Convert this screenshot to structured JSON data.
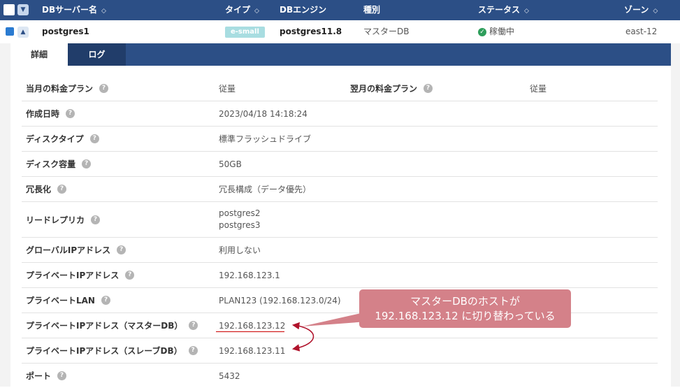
{
  "header": {
    "db_server_name": "DBサーバー名",
    "type": "タイプ",
    "db_engine": "DBエンジン",
    "kind": "種別",
    "status": "ステータス",
    "zone": "ゾーン"
  },
  "row": {
    "name": "postgres1",
    "type_badge": "e-small",
    "engine": "postgres11.8",
    "kind": "マスターDB",
    "status": "稼働中",
    "zone": "east-12"
  },
  "tabs": {
    "detail": "詳細",
    "log": "ログ"
  },
  "details": {
    "plan_current_label": "当月の料金プラン",
    "plan_current_value": "従量",
    "plan_next_label": "翌月の料金プラン",
    "plan_next_value": "従量",
    "created_label": "作成日時",
    "created_value": "2023/04/18 14:18:24",
    "disk_type_label": "ディスクタイプ",
    "disk_type_value": "標準フラッシュドライブ",
    "disk_size_label": "ディスク容量",
    "disk_size_value": "50GB",
    "redundancy_label": "冗長化",
    "redundancy_value": "冗長構成（データ優先）",
    "replica_label": "リードレプリカ",
    "replica_values": [
      "postgres2",
      "postgres3"
    ],
    "global_ip_label": "グローバルIPアドレス",
    "global_ip_value": "利用しない",
    "private_ip_label": "プライベートIPアドレス",
    "private_ip_value": "192.168.123.1",
    "private_lan_label": "プライベートLAN",
    "private_lan_value": "PLAN123 (192.168.123.0/24)",
    "private_ip_master_label": "プライベートIPアドレス（マスターDB）",
    "private_ip_master_value": "192.168.123.12",
    "private_ip_slave_label": "プライベートIPアドレス（スレーブDB）",
    "private_ip_slave_value": "192.168.123.11",
    "port_label": "ポート",
    "port_value": "5432"
  },
  "callout": {
    "line1": "マスターDBのホストが",
    "line2": "192.168.123.12 に切り替わっている"
  },
  "colors": {
    "header": "#2c4f86",
    "callout": "#d48189",
    "arrow": "#b0122b"
  }
}
